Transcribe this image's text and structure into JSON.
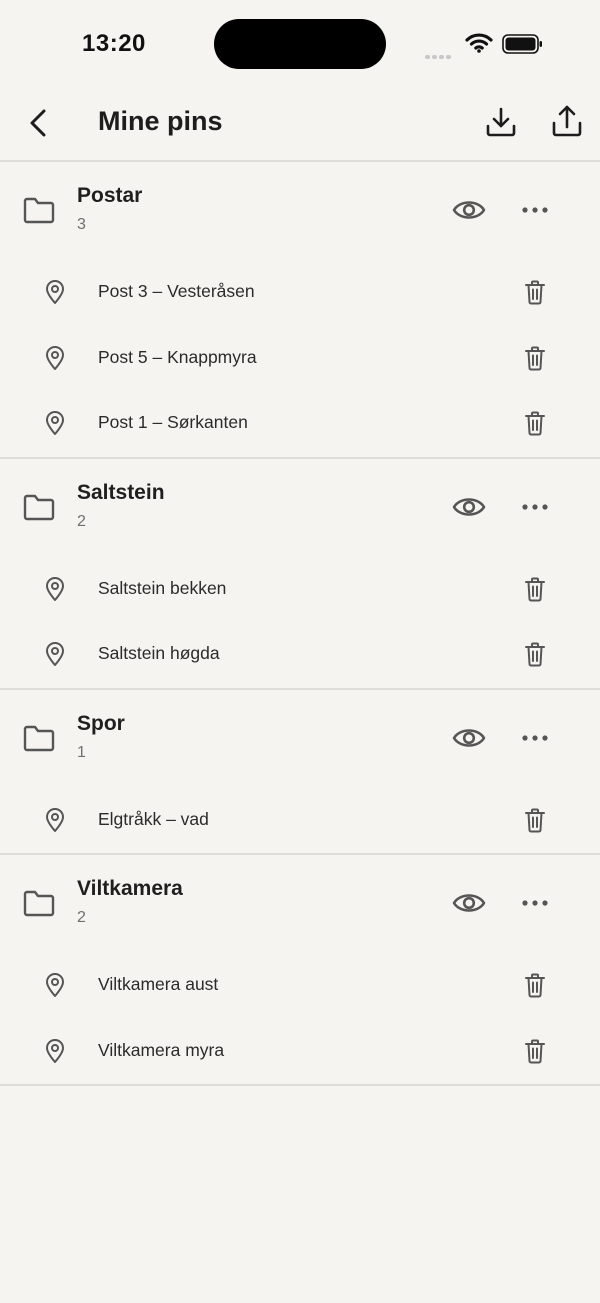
{
  "status_bar": {
    "time": "13:20",
    "icons": [
      "signal-icon",
      "wifi-icon",
      "battery-icon"
    ]
  },
  "header": {
    "title": "Mine pins",
    "icons": [
      "back-arrow-icon",
      "download-icon",
      "share-icon"
    ]
  },
  "groups": [
    {
      "name": "Postar",
      "count": "3",
      "pins": [
        {
          "label": "Post 3 – Vesteråsen"
        },
        {
          "label": "Post 5 – Knappmyra"
        },
        {
          "label": "Post 1 – Sørkanten"
        }
      ]
    },
    {
      "name": "Saltstein",
      "count": "2",
      "pins": [
        {
          "label": "Saltstein bekken"
        },
        {
          "label": "Saltstein høgda"
        }
      ]
    },
    {
      "name": "Spor",
      "count": "1",
      "pins": [
        {
          "label": "Elgtråkk – vad"
        }
      ]
    },
    {
      "name": "Viltkamera",
      "count": "2",
      "pins": [
        {
          "label": "Viltkamera aust"
        },
        {
          "label": "Viltkamera myra"
        }
      ]
    }
  ],
  "colors": {
    "background": "#f5f4f0",
    "divider": "#dedcd7",
    "icon": "#555555",
    "text": "#1f1f1f"
  }
}
